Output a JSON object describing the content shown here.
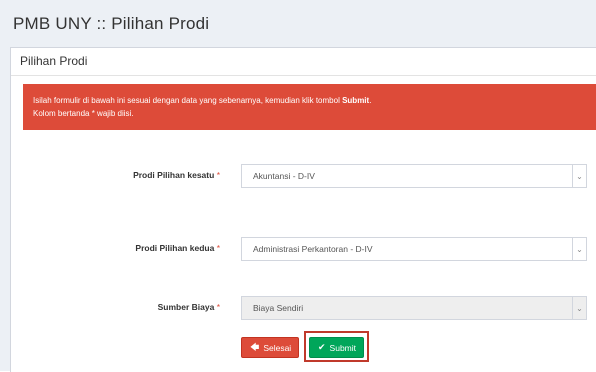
{
  "page": {
    "title": "PMB UNY :: Pilihan Prodi"
  },
  "panel": {
    "title": "Pilihan Prodi"
  },
  "alert": {
    "line1_before": "Isilah formulir di bawah ini sesuai dengan data yang sebenarnya, kemudian klik tombol ",
    "line1_bold": "Submit",
    "line1_after": ".",
    "line2": "Kolom bertanda * wajib diisi."
  },
  "form": {
    "required_mark": "*",
    "prodi1": {
      "label": "Prodi Pilihan kesatu",
      "value": "Akuntansi - D-IV"
    },
    "prodi2": {
      "label": "Prodi Pilihan kedua",
      "value": "Administrasi Perkantoran - D-IV"
    },
    "biaya": {
      "label": "Sumber Biaya",
      "value": "Biaya Sendiri"
    }
  },
  "buttons": {
    "selesai": {
      "label": "Selesai",
      "icon": "arrow-left-icon"
    },
    "submit": {
      "label": "Submit",
      "icon": "check-icon"
    }
  },
  "colors": {
    "alert": "#dd4b39",
    "submit": "#00a65a",
    "highlight": "#c0392b"
  }
}
